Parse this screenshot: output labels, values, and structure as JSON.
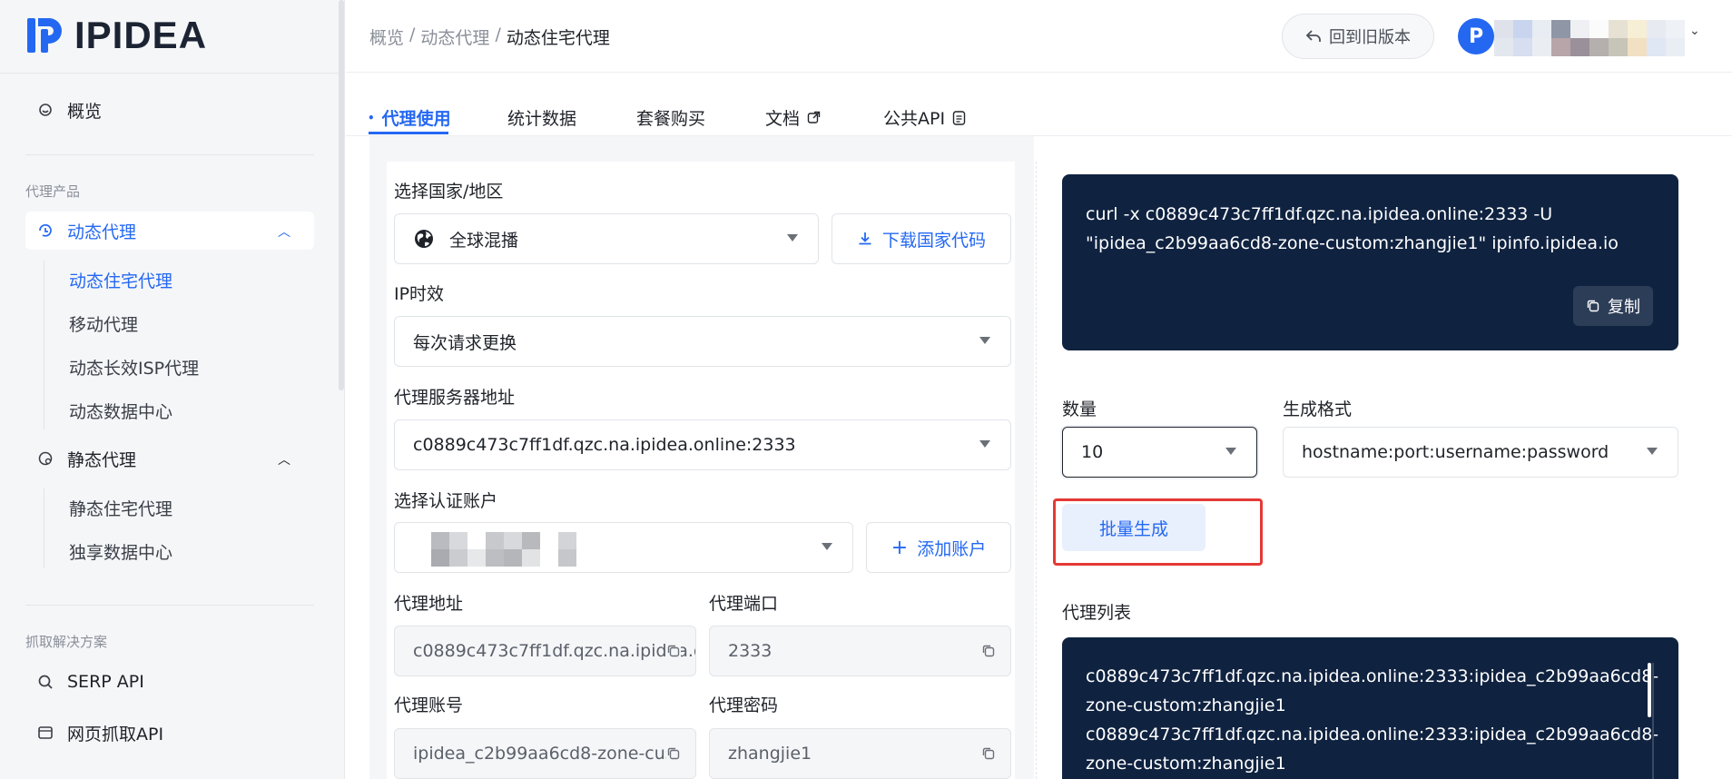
{
  "brand": {
    "name": "IPIDEA"
  },
  "sidebar": {
    "overview": "概览",
    "section_proxy": "代理产品",
    "dynamic": {
      "label": "动态代理",
      "items": [
        "动态住宅代理",
        "移动代理",
        "动态长效ISP代理",
        "动态数据中心"
      ]
    },
    "static": {
      "label": "静态代理",
      "items": [
        "静态住宅代理",
        "独享数据中心"
      ]
    },
    "section_scrape": "抓取解决方案",
    "serp": "SERP API",
    "webscrape": "网页抓取API"
  },
  "breadcrumb": {
    "items": [
      "概览",
      "动态代理"
    ],
    "current": "动态住宅代理",
    "sep": "/"
  },
  "header": {
    "old_version": "回到旧版本",
    "avatar_letter": "P"
  },
  "tabs": [
    {
      "label": "代理使用",
      "active": true
    },
    {
      "label": "统计数据"
    },
    {
      "label": "套餐购买"
    },
    {
      "label": "文档"
    },
    {
      "label": "公共API"
    }
  ],
  "form": {
    "country_label": "选择国家/地区",
    "country_value": "全球混播",
    "download_codes": "下载国家代码",
    "ip_ttl_label": "IP时效",
    "ip_ttl_value": "每次请求更换",
    "server_label": "代理服务器地址",
    "server_value": "c0889c473c7ff1df.qzc.na.ipidea.online:2333",
    "account_label": "选择认证账户",
    "add_account": "添加账户",
    "proxy_addr_label": "代理地址",
    "proxy_addr_value": "c0889c473c7ff1df.qzc.na.ipidea.o",
    "proxy_port_label": "代理端口",
    "proxy_port_value": "2333",
    "proxy_user_label": "代理账号",
    "proxy_user_value": "ipidea_c2b99aa6cd8-zone-cust",
    "proxy_pass_label": "代理密码",
    "proxy_pass_value": "zhangjie1"
  },
  "curl": {
    "line1": "curl -x c0889c473c7ff1df.qzc.na.ipidea.online:2333 -U",
    "line2": "\"ipidea_c2b99aa6cd8-zone-custom:zhangjie1\" ipinfo.ipidea.io",
    "copy": "复制"
  },
  "generate": {
    "qty_label": "数量",
    "qty_value": "10",
    "format_label": "生成格式",
    "format_value": "hostname:port:username:password",
    "button": "批量生成"
  },
  "proxy_list": {
    "label": "代理列表",
    "lines": [
      "c0889c473c7ff1df.qzc.na.ipidea.online:2333:ipidea_c2b99aa6cd8-",
      "zone-custom:zhangjie1",
      "c0889c473c7ff1df.qzc.na.ipidea.online:2333:ipidea_c2b99aa6cd8-",
      "zone-custom:zhangjie1"
    ]
  },
  "colors": {
    "accent": "#2468f2",
    "code_bg": "#0f2240",
    "highlight": "#e53935"
  }
}
